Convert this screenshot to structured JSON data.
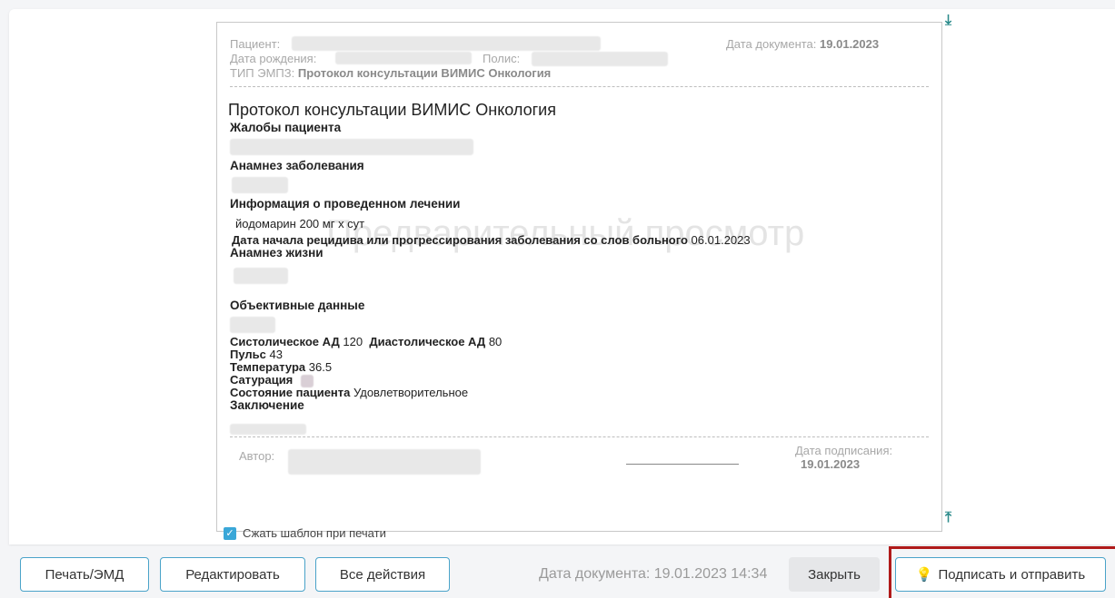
{
  "header": {
    "patient_label": "Пациент:",
    "birth_label": "Дата рождения:",
    "policy_label": "Полис:",
    "emz_type_label": "ТИП ЭМПЗ:",
    "emz_type_value": "Протокол консультации ВИМИС Онкология",
    "doc_date_label": "Дата документа:",
    "doc_date_value": "19.01.2023"
  },
  "document": {
    "title": "Протокол консультации ВИМИС Онкология",
    "watermark": "Предварительный просмотр",
    "complaints": "Жалобы пациента",
    "anamnesis": "Анамнез заболевания",
    "treatment_info": "Информация о проведенном лечении",
    "treatment_value": "йодомарин 200 мг х сут",
    "relapse_label": "Дата начала рецидива или прогрессирования заболевания со слов больного",
    "relapse_value": "06.01.2023",
    "life_anamnesis": "Анамнез жизни",
    "objective": "Объективные данные",
    "sys_label": "Систолическое АД",
    "sys_value": "120",
    "dia_label": "Диастолическое АД",
    "dia_value": "80",
    "pulse_label": "Пульс",
    "pulse_value": "43",
    "temp_label": "Температура",
    "temp_value": "36.5",
    "sat_label": "Сатурация",
    "state_label": "Состояние пациента",
    "state_value": "Удовлетворительное",
    "conclusion": "Заключение"
  },
  "signature": {
    "author_label": "Автор:",
    "sign_date_label": "Дата подписания:",
    "sign_date_value": "19.01.2023"
  },
  "compress_label": "Сжать шаблон при печати",
  "footer": {
    "print_label": "Печать/ЭМД",
    "edit_label": "Редактировать",
    "all_actions_label": "Все действия",
    "doc_date": "Дата документа: 19.01.2023 14:34",
    "close_label": "Закрыть",
    "sign_send_label": "Подписать и отправить"
  },
  "colors": {
    "accent": "#4aa3c9",
    "highlight": "#b01a1a",
    "checkbox": "#3aa7d8"
  }
}
